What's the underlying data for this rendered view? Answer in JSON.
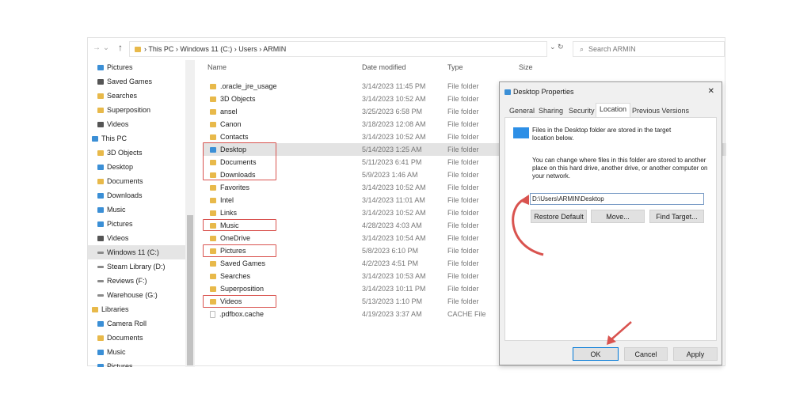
{
  "explorer": {
    "breadcrumb": [
      "This PC",
      "Windows 11 (C:)",
      "Users",
      "ARMIN"
    ],
    "search_placeholder": "Search ARMIN",
    "columns": {
      "name": "Name",
      "date": "Date modified",
      "type": "Type",
      "size": "Size"
    },
    "sidebar": [
      {
        "label": "Pictures",
        "icon": "pictures-icon"
      },
      {
        "label": "Saved Games",
        "icon": "games-icon"
      },
      {
        "label": "Searches",
        "icon": "folder-icon"
      },
      {
        "label": "Superposition",
        "icon": "folder-icon"
      },
      {
        "label": "Videos",
        "icon": "videos-icon"
      },
      {
        "label": "This PC",
        "icon": "computer-icon"
      },
      {
        "label": "3D Objects",
        "icon": "folder-icon"
      },
      {
        "label": "Desktop",
        "icon": "desktop-icon"
      },
      {
        "label": "Documents",
        "icon": "documents-icon"
      },
      {
        "label": "Downloads",
        "icon": "downloads-icon"
      },
      {
        "label": "Music",
        "icon": "music-icon"
      },
      {
        "label": "Pictures",
        "icon": "pictures-icon"
      },
      {
        "label": "Videos",
        "icon": "videos-icon"
      },
      {
        "label": "Windows 11 (C:)",
        "icon": "drive-icon",
        "selected": true
      },
      {
        "label": "Steam Library (D:)",
        "icon": "drive-icon"
      },
      {
        "label": "Reviews (F:)",
        "icon": "drive-icon"
      },
      {
        "label": "Warehouse (G:)",
        "icon": "drive-icon"
      },
      {
        "label": "Libraries",
        "icon": "libraries-icon"
      },
      {
        "label": "Camera Roll",
        "icon": "pictures-icon"
      },
      {
        "label": "Documents",
        "icon": "documents-icon"
      },
      {
        "label": "Music",
        "icon": "music-icon"
      },
      {
        "label": "Pictures",
        "icon": "pictures-icon"
      }
    ],
    "files": [
      {
        "name": ".oracle_jre_usage",
        "date": "3/14/2023 11:45 PM",
        "type": "File folder"
      },
      {
        "name": "3D Objects",
        "date": "3/14/2023 10:52 AM",
        "type": "File folder"
      },
      {
        "name": "ansel",
        "date": "3/25/2023 6:58 PM",
        "type": "File folder"
      },
      {
        "name": "Canon",
        "date": "3/18/2023 12:08 AM",
        "type": "File folder"
      },
      {
        "name": "Contacts",
        "date": "3/14/2023 10:52 AM",
        "type": "File folder"
      },
      {
        "name": "Desktop",
        "date": "5/14/2023 1:25 AM",
        "type": "File folder",
        "selected": true
      },
      {
        "name": "Documents",
        "date": "5/11/2023 6:41 PM",
        "type": "File folder"
      },
      {
        "name": "Downloads",
        "date": "5/9/2023 1:46 AM",
        "type": "File folder"
      },
      {
        "name": "Favorites",
        "date": "3/14/2023 10:52 AM",
        "type": "File folder"
      },
      {
        "name": "Intel",
        "date": "3/14/2023 11:01 AM",
        "type": "File folder"
      },
      {
        "name": "Links",
        "date": "3/14/2023 10:52 AM",
        "type": "File folder"
      },
      {
        "name": "Music",
        "date": "4/28/2023 4:03 AM",
        "type": "File folder"
      },
      {
        "name": "OneDrive",
        "date": "3/14/2023 10:54 AM",
        "type": "File folder"
      },
      {
        "name": "Pictures",
        "date": "5/8/2023 6:10 PM",
        "type": "File folder"
      },
      {
        "name": "Saved Games",
        "date": "4/2/2023 4:51 PM",
        "type": "File folder"
      },
      {
        "name": "Searches",
        "date": "3/14/2023 10:53 AM",
        "type": "File folder"
      },
      {
        "name": "Superposition",
        "date": "3/14/2023 10:11 PM",
        "type": "File folder"
      },
      {
        "name": "Videos",
        "date": "5/13/2023 1:10 PM",
        "type": "File folder"
      },
      {
        "name": ".pdfbox.cache",
        "date": "4/19/2023 3:37 AM",
        "type": "CACHE File"
      }
    ]
  },
  "dialog": {
    "title": "Desktop Properties",
    "close": "✕",
    "tabs": [
      "General",
      "Sharing",
      "Security",
      "Location",
      "Previous Versions"
    ],
    "active_tab": "Location",
    "info": "Files in the Desktop folder are stored in the target location below.",
    "desc": "You can change where files in this folder are stored to another place on this hard drive, another drive, or another computer on your network.",
    "path": "D:\\Users\\ARMIN\\Desktop",
    "buttons": {
      "restore": "Restore Default",
      "move": "Move...",
      "find": "Find Target...",
      "ok": "OK",
      "cancel": "Cancel",
      "apply": "Apply"
    }
  },
  "annotation_color": "#d9534f"
}
